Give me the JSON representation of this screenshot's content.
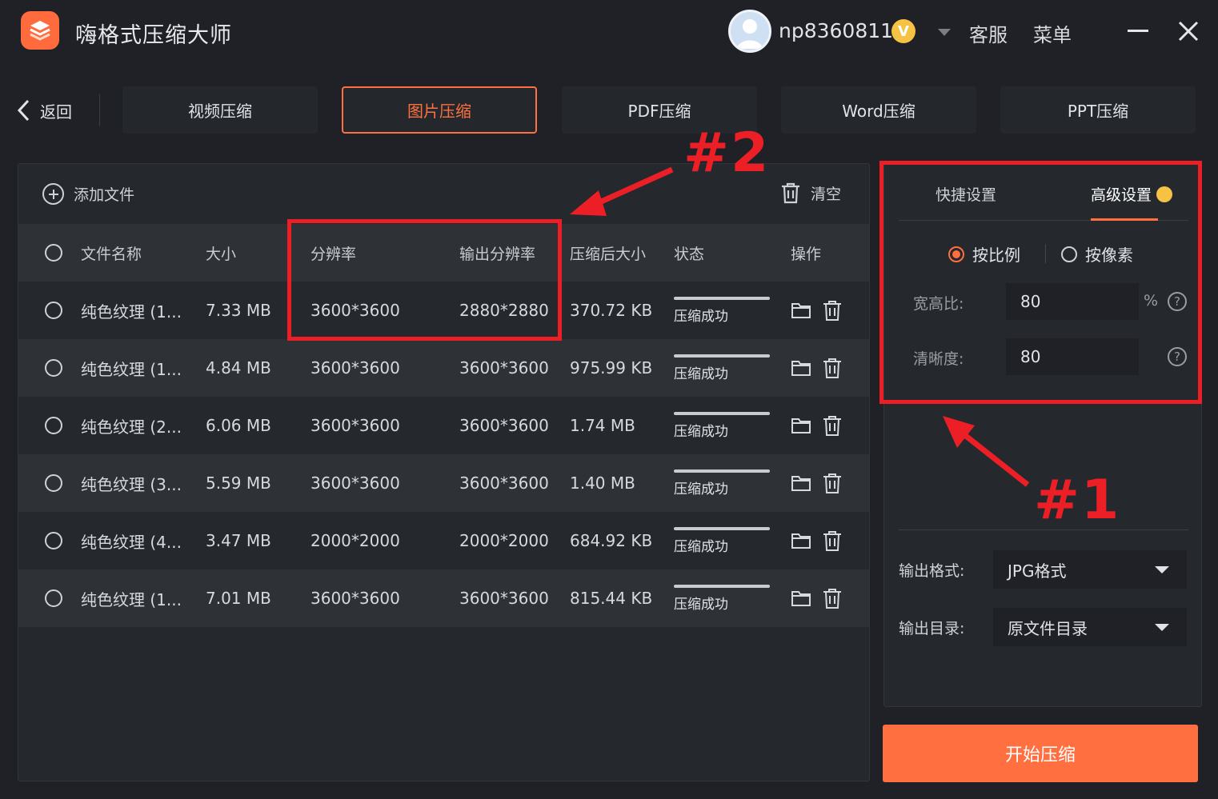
{
  "app": {
    "title": "嗨格式压缩大师"
  },
  "user": {
    "name": "np8360811",
    "vip_badge": "V"
  },
  "header_links": {
    "service": "客服",
    "menu": "菜单"
  },
  "nav": {
    "back_label": "返回",
    "tabs": [
      {
        "label": "视频压缩",
        "active": false
      },
      {
        "label": "图片压缩",
        "active": true
      },
      {
        "label": "PDF压缩",
        "active": false
      },
      {
        "label": "Word压缩",
        "active": false
      },
      {
        "label": "PPT压缩",
        "active": false
      }
    ]
  },
  "toolbar": {
    "add_file": "添加文件",
    "clear": "清空"
  },
  "table": {
    "headers": {
      "name": "文件名称",
      "size": "大小",
      "resolution": "分辨率",
      "output_resolution": "输出分辨率",
      "compressed_size": "压缩后大小",
      "status": "状态",
      "actions": "操作"
    },
    "rows": [
      {
        "name": "纯色纹理 (1...",
        "size": "7.33 MB",
        "resolution": "3600*3600",
        "output_resolution": "2880*2880",
        "compressed_size": "370.72 KB",
        "status": "压缩成功"
      },
      {
        "name": "纯色纹理 (1...",
        "size": "4.84 MB",
        "resolution": "3600*3600",
        "output_resolution": "3600*3600",
        "compressed_size": "975.99 KB",
        "status": "压缩成功"
      },
      {
        "name": "纯色纹理 (2...",
        "size": "6.06 MB",
        "resolution": "3600*3600",
        "output_resolution": "3600*3600",
        "compressed_size": "1.74 MB",
        "status": "压缩成功"
      },
      {
        "name": "纯色纹理 (3...",
        "size": "5.59 MB",
        "resolution": "3600*3600",
        "output_resolution": "3600*3600",
        "compressed_size": "1.40 MB",
        "status": "压缩成功"
      },
      {
        "name": "纯色纹理 (4...",
        "size": "3.47 MB",
        "resolution": "2000*2000",
        "output_resolution": "2000*2000",
        "compressed_size": "684.92 KB",
        "status": "压缩成功"
      },
      {
        "name": "纯色纹理 (1...",
        "size": "7.01 MB",
        "resolution": "3600*3600",
        "output_resolution": "3600*3600",
        "compressed_size": "815.44 KB",
        "status": "压缩成功"
      }
    ]
  },
  "settings": {
    "tabs": {
      "quick": "快捷设置",
      "advanced": "高级设置"
    },
    "mode": {
      "ratio": "按比例",
      "pixel": "按像素",
      "selected": "ratio"
    },
    "aspect_label": "宽高比:",
    "aspect_value": "80",
    "aspect_unit": "%",
    "clarity_label": "清晰度:",
    "clarity_value": "80",
    "help_glyph": "?",
    "output_format_label": "输出格式:",
    "output_format_value": "JPG格式",
    "output_dir_label": "输出目录:",
    "output_dir_value": "原文件目录"
  },
  "start_button": "开始压缩",
  "annotations": {
    "label_1": "#1",
    "label_2": "#2",
    "color": "#ec1f27"
  },
  "colors": {
    "accent": "#ff6f3f",
    "background": "#1f2126",
    "panel": "#25282d"
  }
}
